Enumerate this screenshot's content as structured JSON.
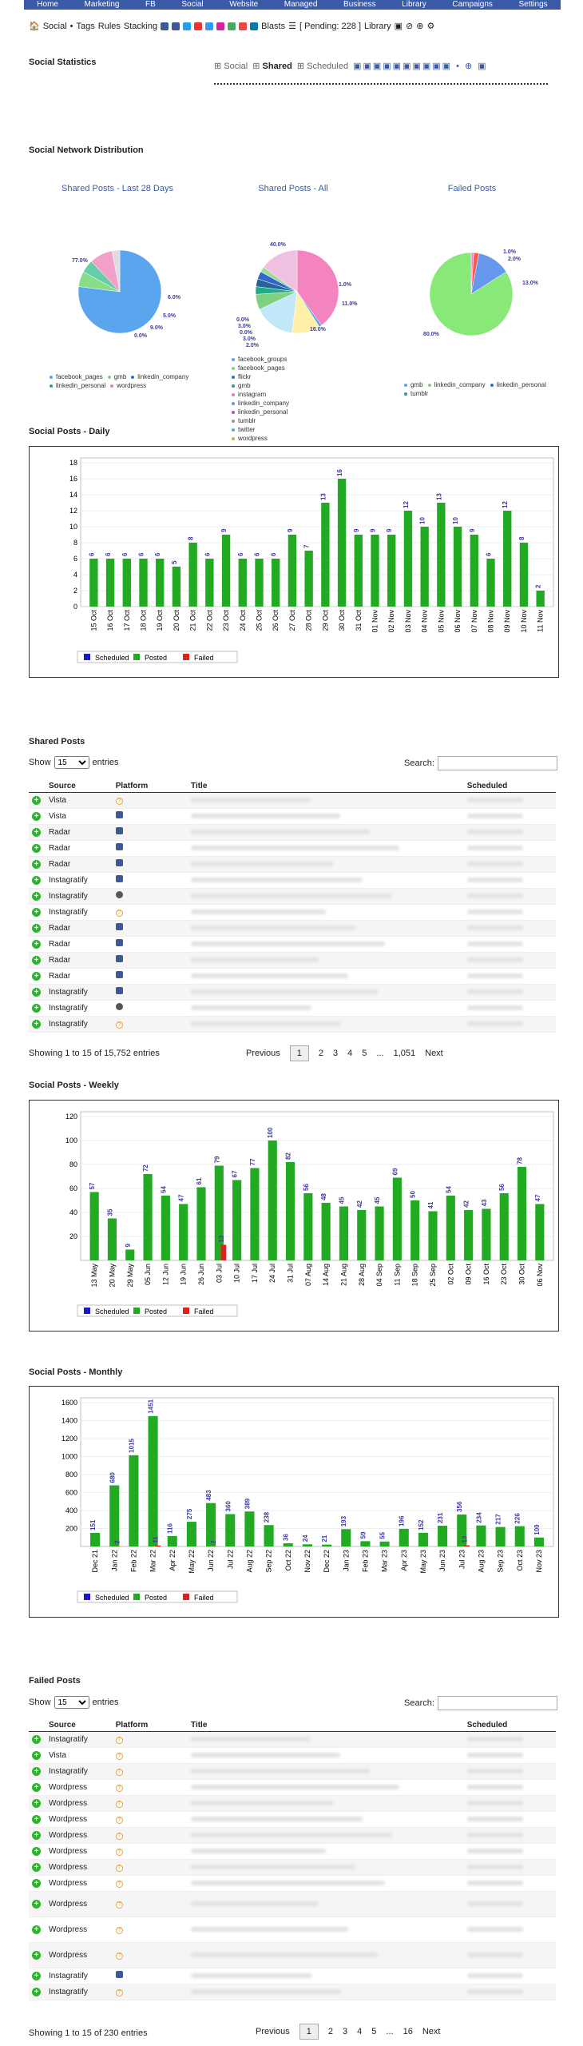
{
  "nav": [
    "Home",
    "Marketing",
    "FB",
    "Social",
    "Website",
    "Managed",
    "Business",
    "Library",
    "Campaigns",
    "Settings"
  ],
  "toolbar": {
    "social": "Social",
    "tags": "Tags",
    "rules": "Rules",
    "stacking": "Stacking",
    "blasts": "Blasts",
    "pending": "[ Pending: 228 ]",
    "library": "Library"
  },
  "headings": {
    "stats": "Social Statistics",
    "dist": "Social Network Distribution",
    "daily": "Social Posts - Daily",
    "shared": "Shared Posts",
    "weekly": "Social Posts - Weekly",
    "monthly": "Social Posts - Monthly",
    "failed": "Failed Posts"
  },
  "subbar": {
    "social": "Social",
    "shared": "Shared",
    "scheduled": "Scheduled"
  },
  "pies": [
    {
      "title": "Shared Posts - Last 28 Days",
      "labels": [
        "77.0%",
        "6.0%",
        "5.0%",
        "9.0%",
        "0.0%"
      ],
      "legend": [
        "facebook_pages",
        "gmb",
        "linkedin_company",
        "linkedin_personal",
        "wordpress"
      ]
    },
    {
      "title": "Shared Posts - All",
      "labels": [
        "40.0%",
        "1.0%",
        "11.0%",
        "16.0%",
        "0.0%",
        "3.0%",
        "0.0%",
        "3.0%",
        "2.0%"
      ],
      "legend": [
        "facebook_groups",
        "facebook_pages",
        "flickr",
        "gmb",
        "instagram",
        "linkedin_company",
        "linkedin_personal",
        "tumblr",
        "twitter",
        "wordpress"
      ]
    },
    {
      "title": "Failed Posts",
      "labels": [
        "1.0%",
        "2.0%",
        "13.0%",
        "80.0%"
      ],
      "legend": [
        "gmb",
        "linkedin_company",
        "linkedin_personal",
        "tumblr"
      ]
    }
  ],
  "colors": {
    "nav": "#3a5aa8",
    "posted": "#22aa22",
    "scheduled": "#1a1acc",
    "failed": "#dd2222",
    "label": "#3a3aa0"
  },
  "chart_legend": [
    "Scheduled",
    "Posted",
    "Failed"
  ],
  "chart_data": [
    {
      "type": "bar",
      "title": "Social Posts - Daily",
      "categories": [
        "15 Oct",
        "16 Oct",
        "17 Oct",
        "18 Oct",
        "19 Oct",
        "20 Oct",
        "21 Oct",
        "22 Oct",
        "23 Oct",
        "24 Oct",
        "25 Oct",
        "26 Oct",
        "27 Oct",
        "28 Oct",
        "29 Oct",
        "30 Oct",
        "31 Oct",
        "01 Nov",
        "02 Nov",
        "03 Nov",
        "04 Nov",
        "05 Nov",
        "06 Nov",
        "07 Nov",
        "08 Nov",
        "09 Nov",
        "10 Nov",
        "11 Nov"
      ],
      "series": [
        {
          "name": "Posted",
          "values": [
            6,
            6,
            6,
            6,
            6,
            5,
            8,
            6,
            9,
            6,
            6,
            6,
            9,
            7,
            13,
            16,
            9,
            9,
            9,
            12,
            10,
            13,
            10,
            9,
            6,
            12,
            8,
            2
          ]
        }
      ],
      "ylim": [
        0,
        18
      ],
      "yticks": [
        0,
        2,
        4,
        6,
        8,
        10,
        12,
        14,
        16,
        18
      ]
    },
    {
      "type": "bar",
      "title": "Social Posts - Weekly",
      "categories": [
        "13 May",
        "20 May",
        "29 May",
        "05 Jun",
        "12 Jun",
        "19 Jun",
        "26 Jun",
        "03 Jul",
        "10 Jul",
        "17 Jul",
        "24 Jul",
        "31 Jul",
        "07 Aug",
        "14 Aug",
        "21 Aug",
        "28 Aug",
        "04 Sep",
        "11 Sep",
        "18 Sep",
        "25 Sep",
        "02 Oct",
        "09 Oct",
        "16 Oct",
        "23 Oct",
        "30 Oct",
        "06 Nov"
      ],
      "series": [
        {
          "name": "Posted",
          "values": [
            57,
            35,
            9,
            72,
            54,
            47,
            61,
            79,
            67,
            77,
            100,
            82,
            56,
            48,
            45,
            42,
            45,
            69,
            50,
            41,
            54,
            42,
            43,
            56,
            78,
            47
          ]
        },
        {
          "name": "Failed",
          "values": [
            0,
            0,
            0,
            0,
            0,
            0,
            0,
            13,
            0,
            0,
            0,
            0,
            0,
            0,
            0,
            0,
            0,
            0,
            0,
            0,
            0,
            0,
            0,
            0,
            0,
            0
          ]
        }
      ],
      "ylim": [
        0,
        120
      ],
      "yticks": [
        20,
        40,
        60,
        80,
        100,
        120
      ]
    },
    {
      "type": "bar",
      "title": "Social Posts - Monthly",
      "categories": [
        "Dec 21",
        "Jan 22",
        "Feb 22",
        "Mar 22",
        "Apr 22",
        "May 22",
        "Jun 22",
        "Jul 22",
        "Aug 22",
        "Sep 22",
        "Oct 22",
        "Nov 22",
        "Dec 22",
        "Jan 23",
        "Feb 23",
        "Mar 23",
        "Apr 23",
        "May 23",
        "Jun 23",
        "Jul 23",
        "Aug 23",
        "Sep 23",
        "Oct 23",
        "Nov 23"
      ],
      "series": [
        {
          "name": "Posted",
          "values": [
            151,
            680,
            1015,
            1451,
            116,
            275,
            483,
            360,
            389,
            238,
            36,
            24,
            21,
            193,
            59,
            55,
            196,
            152,
            231,
            356,
            234,
            217,
            226,
            100
          ]
        },
        {
          "name": "Failed",
          "values": [
            0,
            2,
            0,
            11,
            0,
            0,
            2,
            0,
            0,
            0,
            0,
            0,
            0,
            0,
            0,
            0,
            0,
            0,
            0,
            13,
            0,
            0,
            0,
            0
          ]
        }
      ],
      "ylim": [
        0,
        1600
      ],
      "yticks": [
        200,
        400,
        600,
        800,
        1000,
        1200,
        1400,
        1600
      ]
    }
  ],
  "shared": {
    "show": "Show",
    "entries": "entries",
    "search": "Search:",
    "select": "15",
    "cols": [
      "Source",
      "Platform",
      "Title",
      "Scheduled"
    ],
    "rows": [
      [
        "Vista",
        "q"
      ],
      [
        "Vista",
        "f"
      ],
      [
        "Radar",
        "f"
      ],
      [
        "Radar",
        "f"
      ],
      [
        "Radar",
        "f"
      ],
      [
        "Instagratify",
        "f"
      ],
      [
        "Instagratify",
        "g"
      ],
      [
        "Instagratify",
        "q"
      ],
      [
        "Radar",
        "f"
      ],
      [
        "Radar",
        "f"
      ],
      [
        "Radar",
        "f"
      ],
      [
        "Radar",
        "f"
      ],
      [
        "Instagratify",
        "f"
      ],
      [
        "Instagratify",
        "g"
      ],
      [
        "Instagratify",
        "q"
      ]
    ],
    "info": "Showing 1 to 15 of 15,752 entries",
    "pages": [
      "Previous",
      "1",
      "2",
      "3",
      "4",
      "5",
      "...",
      "1,051",
      "Next"
    ]
  },
  "failed": {
    "show": "Show",
    "entries": "entries",
    "search": "Search:",
    "select": "15",
    "cols": [
      "Source",
      "Platform",
      "Title",
      "Scheduled"
    ],
    "rows": [
      [
        "Instagratify",
        "q"
      ],
      [
        "Vista",
        "q"
      ],
      [
        "Instagratify",
        "q"
      ],
      [
        "Wordpress",
        "q"
      ],
      [
        "Wordpress",
        "q"
      ],
      [
        "Wordpress",
        "q"
      ],
      [
        "Wordpress",
        "q"
      ],
      [
        "Wordpress",
        "q"
      ],
      [
        "Wordpress",
        "q"
      ],
      [
        "Wordpress",
        "q"
      ],
      [
        "Wordpress",
        "q"
      ],
      [
        "Wordpress",
        "q"
      ],
      [
        "Wordpress",
        "q"
      ],
      [
        "Instagratify",
        "f"
      ],
      [
        "Instagratify",
        "q"
      ]
    ],
    "info": "Showing 1 to 15 of 230 entries",
    "pages": [
      "Previous",
      "1",
      "2",
      "3",
      "4",
      "5",
      "...",
      "16",
      "Next"
    ]
  }
}
